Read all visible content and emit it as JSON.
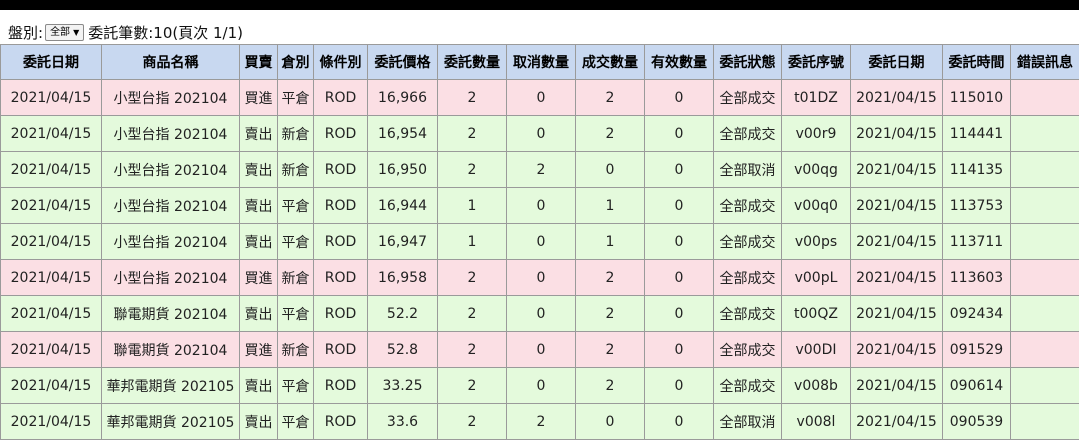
{
  "filter": {
    "label": "盤別:",
    "selected": "全部",
    "summary": "委託筆數:10(頁次 1/1)"
  },
  "columns": [
    "委託日期",
    "商品名稱",
    "買賣",
    "倉別",
    "條件別",
    "委託價格",
    "委託數量",
    "取消數量",
    "成交數量",
    "有效數量",
    "委託狀態",
    "委託序號",
    "委託日期",
    "委託時間",
    "錯誤訊息"
  ],
  "colors": {
    "buy_row": "#fbdfe4",
    "sell_row": "#e4fadc",
    "buy_text": "#d81e1e",
    "sell_text": "#1d8a1d",
    "header_bg": "#c8d8f0"
  },
  "rows": [
    {
      "side_type": "buy",
      "cells": [
        "2021/04/15",
        "小型台指 202104",
        "買進",
        "平倉",
        "ROD",
        "16,966",
        "2",
        "0",
        "2",
        "0",
        "全部成交",
        "t01DZ",
        "2021/04/15",
        "115010",
        ""
      ]
    },
    {
      "side_type": "sell",
      "cells": [
        "2021/04/15",
        "小型台指 202104",
        "賣出",
        "新倉",
        "ROD",
        "16,954",
        "2",
        "0",
        "2",
        "0",
        "全部成交",
        "v00r9",
        "2021/04/15",
        "114441",
        ""
      ]
    },
    {
      "side_type": "sell",
      "cells": [
        "2021/04/15",
        "小型台指 202104",
        "賣出",
        "新倉",
        "ROD",
        "16,950",
        "2",
        "2",
        "0",
        "0",
        "全部取消",
        "v00qg",
        "2021/04/15",
        "114135",
        ""
      ]
    },
    {
      "side_type": "sell",
      "cells": [
        "2021/04/15",
        "小型台指 202104",
        "賣出",
        "平倉",
        "ROD",
        "16,944",
        "1",
        "0",
        "1",
        "0",
        "全部成交",
        "v00q0",
        "2021/04/15",
        "113753",
        ""
      ]
    },
    {
      "side_type": "sell",
      "cells": [
        "2021/04/15",
        "小型台指 202104",
        "賣出",
        "平倉",
        "ROD",
        "16,947",
        "1",
        "0",
        "1",
        "0",
        "全部成交",
        "v00ps",
        "2021/04/15",
        "113711",
        ""
      ]
    },
    {
      "side_type": "buy",
      "cells": [
        "2021/04/15",
        "小型台指 202104",
        "買進",
        "新倉",
        "ROD",
        "16,958",
        "2",
        "0",
        "2",
        "0",
        "全部成交",
        "v00pL",
        "2021/04/15",
        "113603",
        ""
      ]
    },
    {
      "side_type": "sell",
      "cells": [
        "2021/04/15",
        "聯電期貨 202104",
        "賣出",
        "平倉",
        "ROD",
        "52.2",
        "2",
        "0",
        "2",
        "0",
        "全部成交",
        "t00QZ",
        "2021/04/15",
        "092434",
        ""
      ]
    },
    {
      "side_type": "buy",
      "cells": [
        "2021/04/15",
        "聯電期貨 202104",
        "買進",
        "新倉",
        "ROD",
        "52.8",
        "2",
        "0",
        "2",
        "0",
        "全部成交",
        "v00DI",
        "2021/04/15",
        "091529",
        ""
      ]
    },
    {
      "side_type": "sell",
      "cells": [
        "2021/04/15",
        "華邦電期貨 202105",
        "賣出",
        "平倉",
        "ROD",
        "33.25",
        "2",
        "0",
        "2",
        "0",
        "全部成交",
        "v008b",
        "2021/04/15",
        "090614",
        ""
      ]
    },
    {
      "side_type": "sell",
      "cells": [
        "2021/04/15",
        "華邦電期貨 202105",
        "賣出",
        "平倉",
        "ROD",
        "33.6",
        "2",
        "2",
        "0",
        "0",
        "全部取消",
        "v008l",
        "2021/04/15",
        "090539",
        ""
      ]
    }
  ]
}
